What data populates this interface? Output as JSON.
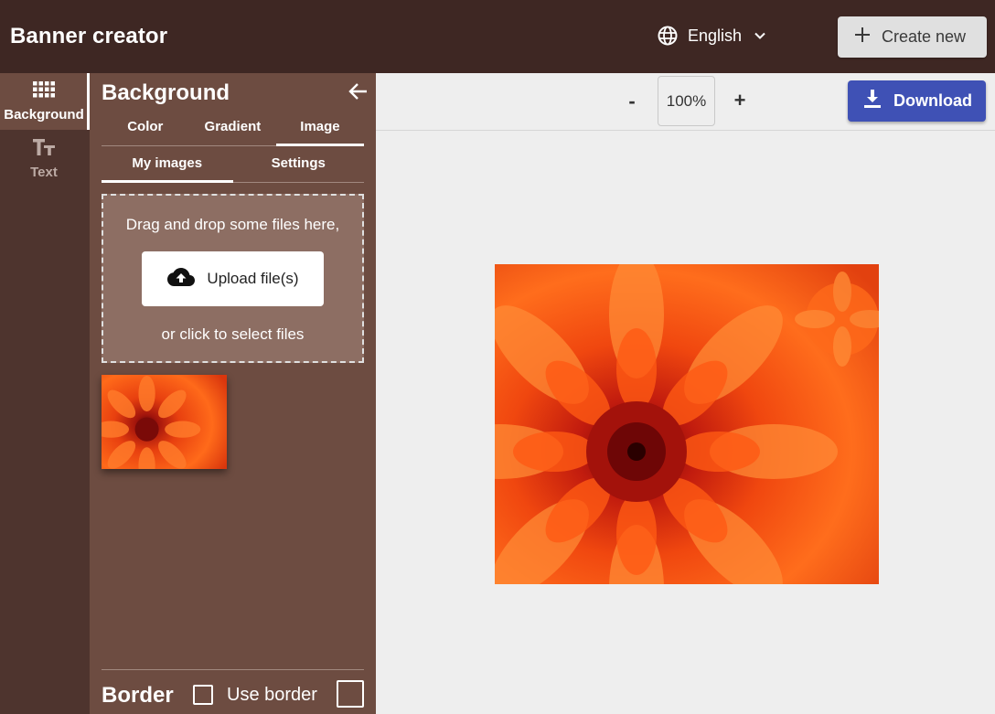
{
  "app": {
    "title": "Banner creator"
  },
  "language": {
    "selected": "English"
  },
  "header": {
    "create_label": "Create new"
  },
  "rail": {
    "items": [
      {
        "label": "Background",
        "icon": "grid-icon"
      },
      {
        "label": "Text",
        "icon": "text-size-icon"
      }
    ]
  },
  "panel": {
    "title": "Background",
    "tabs": [
      "Color",
      "Gradient",
      "Image"
    ],
    "active_tab": "Image",
    "subtabs": [
      "My images",
      "Settings"
    ],
    "active_subtab": "My images",
    "dropzone": {
      "text": "Drag and drop some files here,",
      "upload_label": "Upload file(s)",
      "text2": "or click to select files"
    },
    "border": {
      "title": "Border",
      "use_border_label": "Use border",
      "use_border_checked": false
    }
  },
  "toolbar": {
    "zoom_out": "-",
    "zoom": "100%",
    "zoom_in": "+",
    "download_label": "Download"
  },
  "colors": {
    "topbar": "#3e2723",
    "rail": "#4e342e",
    "panel": "#6d4c41",
    "download": "#3f51b5",
    "flower_center": "#8b0a0a",
    "flower_petal": "#ff5a14"
  }
}
